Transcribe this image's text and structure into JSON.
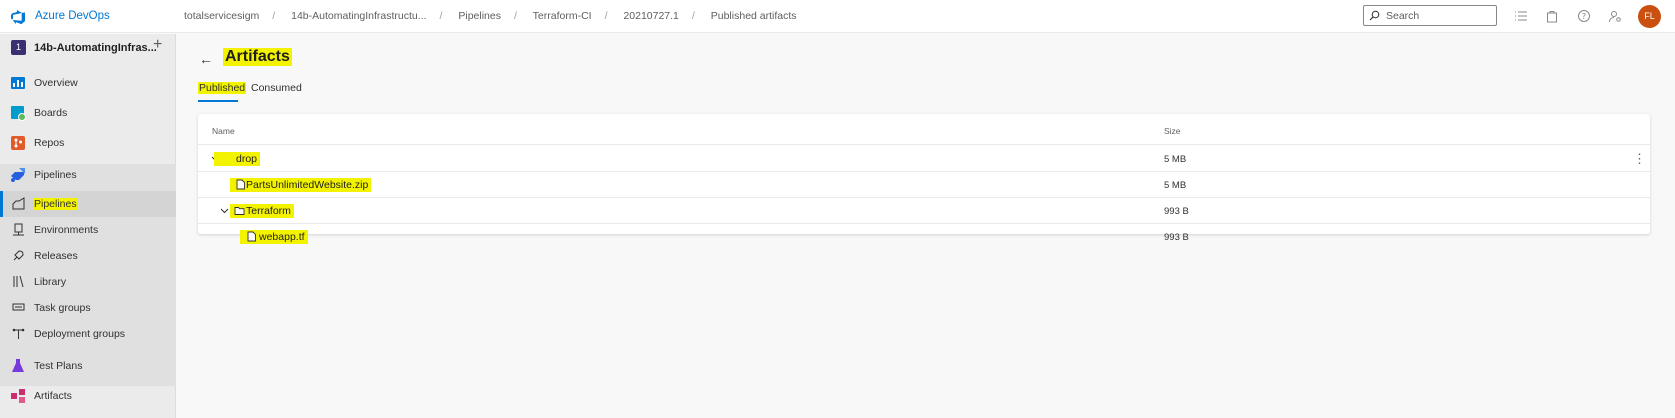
{
  "header": {
    "brand": "Azure DevOps",
    "breadcrumbs": [
      "totalservicesigm",
      "14b-AutomatingInfrastructu...",
      "Pipelines",
      "Terraform-CI",
      "20210727.1",
      "Published artifacts"
    ],
    "search_placeholder": "Search",
    "user_initials": "FL",
    "accent": "#0078d4",
    "avatar_color": "#ca5010"
  },
  "sidebar": {
    "project_initial": "1",
    "project_name": "14b-AutomatingInfras...",
    "items": [
      {
        "label": "Overview",
        "icon": "overview-icon"
      },
      {
        "label": "Boards",
        "icon": "boards-icon"
      },
      {
        "label": "Repos",
        "icon": "repos-icon"
      },
      {
        "label": "Pipelines",
        "icon": "pipelines-icon"
      },
      {
        "label": "Test Plans",
        "icon": "test-plans-icon"
      },
      {
        "label": "Artifacts",
        "icon": "artifacts-icon"
      }
    ],
    "pipeline_subitems": [
      {
        "label": "Pipelines",
        "icon": "pipelines-sub-icon",
        "active": true
      },
      {
        "label": "Environments",
        "icon": "environments-icon"
      },
      {
        "label": "Releases",
        "icon": "releases-icon"
      },
      {
        "label": "Library",
        "icon": "library-icon"
      },
      {
        "label": "Task groups",
        "icon": "task-groups-icon"
      },
      {
        "label": "Deployment groups",
        "icon": "deployment-groups-icon"
      }
    ]
  },
  "page": {
    "title": "Artifacts",
    "tabs": [
      {
        "label": "Published",
        "selected": true
      },
      {
        "label": "Consumed",
        "selected": false
      }
    ]
  },
  "table": {
    "columns": [
      "Name",
      "Size"
    ],
    "rows": [
      {
        "name": "drop",
        "size": "5 MB",
        "type": "artifact",
        "expanded": true
      },
      {
        "name": "PartsUnlimitedWebsite.zip",
        "size": "5 MB",
        "type": "file"
      },
      {
        "name": "Terraform",
        "size": "993 B",
        "type": "folder",
        "expanded": true
      },
      {
        "name": "webapp.tf",
        "size": "993 B",
        "type": "file"
      }
    ]
  },
  "highlight_color": "#f3f300"
}
